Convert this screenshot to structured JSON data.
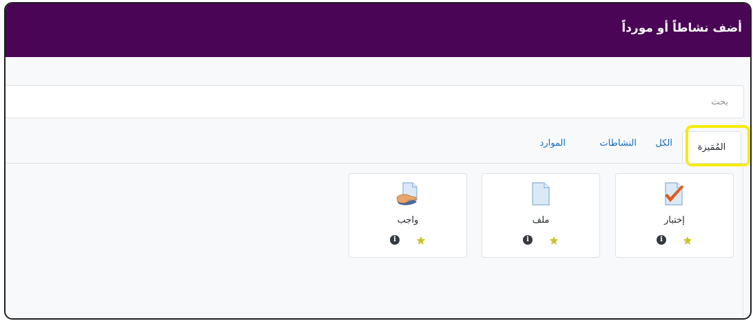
{
  "header": {
    "title": "أضف نشاطاً أو مورداً"
  },
  "search": {
    "placeholder": "بحث",
    "value": ""
  },
  "tabs": [
    {
      "label": "المُمَيزة",
      "active": true
    },
    {
      "label": "الكل"
    },
    {
      "label": "النشاطات"
    },
    {
      "label": "الموارد"
    }
  ],
  "items": [
    {
      "label": "إختبار",
      "icon": "quiz-icon",
      "starred": true
    },
    {
      "label": "ملف",
      "icon": "file-icon",
      "starred": true
    },
    {
      "label": "واجب",
      "icon": "assignment-icon",
      "starred": true
    }
  ],
  "icons": {
    "star": "star-icon",
    "info": "info-icon"
  },
  "colors": {
    "header_bg": "#4a0556",
    "link": "#0f6cbf",
    "star": "#c6c72e",
    "highlight": "#f5ec00"
  }
}
